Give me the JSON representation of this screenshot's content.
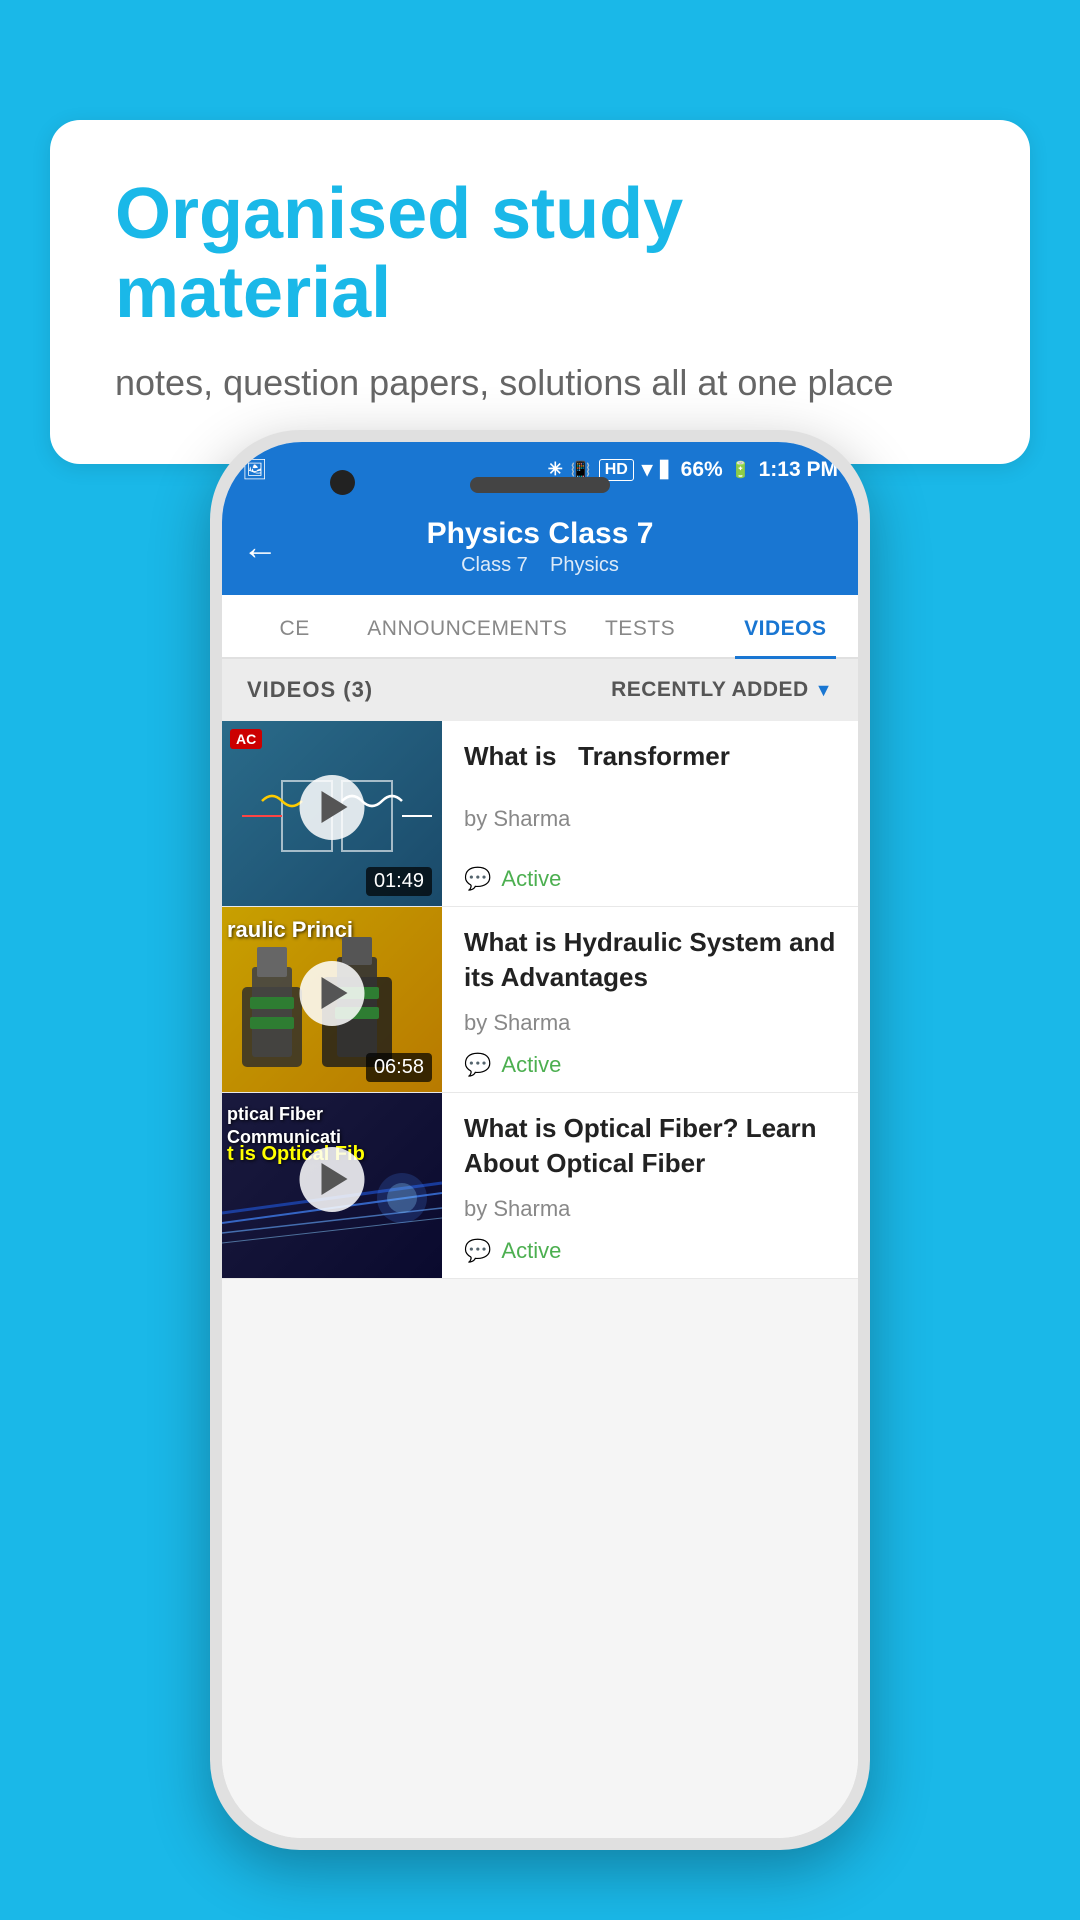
{
  "background_color": "#1ab8e8",
  "bubble": {
    "title": "Organised study material",
    "subtitle": "notes, question papers, solutions all at one place"
  },
  "status_bar": {
    "battery": "66%",
    "time": "1:13 PM",
    "signal": "HD"
  },
  "app_bar": {
    "title": "Physics Class 7",
    "subtitle_class": "Class 7",
    "subtitle_subject": "Physics",
    "back_icon": "←"
  },
  "tabs": [
    {
      "label": "CE",
      "active": false
    },
    {
      "label": "ANNOUNCEMENTS",
      "active": false
    },
    {
      "label": "TESTS",
      "active": false
    },
    {
      "label": "VIDEOS",
      "active": true
    }
  ],
  "videos_header": {
    "count_label": "VIDEOS (3)",
    "sort_label": "RECENTLY ADDED",
    "sort_icon": "▼"
  },
  "videos": [
    {
      "title": "What is  Transformer",
      "author": "by Sharma",
      "status": "Active",
      "duration": "01:49",
      "thumb_type": "dark_blue",
      "thumb_label": "AC"
    },
    {
      "title": "What is Hydraulic System and its Advantages",
      "author": "by Sharma",
      "status": "Active",
      "duration": "06:58",
      "thumb_type": "yellow",
      "thumb_text": "raulic Princi"
    },
    {
      "title": "What is Optical Fiber? Learn About Optical Fiber",
      "author": "by Sharma",
      "status": "Active",
      "duration": "",
      "thumb_type": "dark",
      "thumb_text": "ptical Fiber Communicati",
      "thumb_text2": "t is Optical Fib"
    }
  ]
}
